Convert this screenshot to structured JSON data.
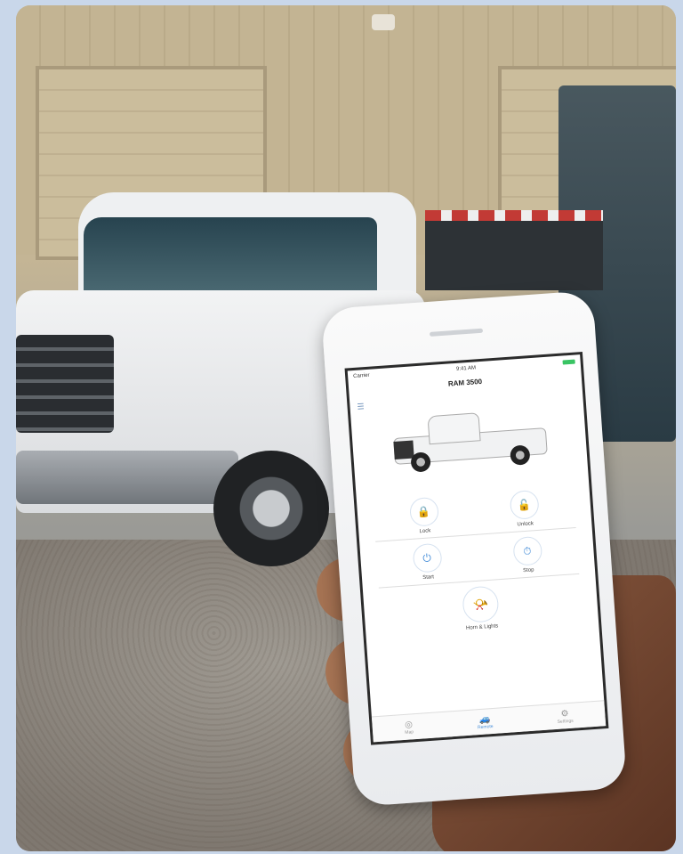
{
  "colors": {
    "background": "#c9d7ea",
    "accent": "#4a90d9",
    "battery": "#39c463"
  },
  "app": {
    "status_left": "Carrier",
    "status_time": "9:41 AM",
    "title": "RAM 3500",
    "menu_icon": "hamburger-icon"
  },
  "controls": [
    {
      "label": "Lock",
      "icon": "lock-icon"
    },
    {
      "label": "Unlock",
      "icon": "unlock-icon"
    },
    {
      "label": "Start",
      "icon": "power-icon"
    },
    {
      "label": "Stop",
      "icon": "stop-icon"
    },
    {
      "label": "Horn & Lights",
      "icon": "horn-icon"
    }
  ],
  "tabs": [
    {
      "label": "Map",
      "icon": "map-icon",
      "active": false
    },
    {
      "label": "Remote",
      "icon": "car-icon",
      "active": true
    },
    {
      "label": "Settings",
      "icon": "gear-icon",
      "active": false
    }
  ]
}
